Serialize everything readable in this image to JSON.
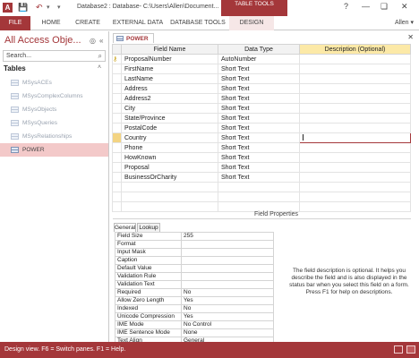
{
  "window": {
    "title": "Database2 : Database- C:\\Users\\Allen\\Document...",
    "contextual_group": "TABLE TOOLS",
    "app_icon": "A",
    "help": "?",
    "minimize": "—",
    "restore": "❏",
    "close": "✕",
    "qat": {
      "save": "💾",
      "undo": "↶",
      "undo_dropdown": "▾",
      "customize": "▾"
    }
  },
  "ribbon": {
    "tabs": [
      "FILE",
      "HOME",
      "CREATE",
      "EXTERNAL DATA",
      "DATABASE TOOLS",
      "DESIGN"
    ],
    "account": "Allen ▾"
  },
  "nav_pane": {
    "title": "All Access Obje...",
    "dropdown": "◎",
    "collapse": "«",
    "search_placeholder": "Search...",
    "search_icon": "⌕",
    "section": "Tables",
    "section_collapse": "˄",
    "items": [
      {
        "label": "MSysACEs",
        "active": false
      },
      {
        "label": "MSysComplexColumns",
        "active": false
      },
      {
        "label": "MSysObjects",
        "active": false
      },
      {
        "label": "MSysQueries",
        "active": false
      },
      {
        "label": "MSysRelationships",
        "active": false
      },
      {
        "label": "POWER",
        "active": true
      }
    ]
  },
  "document": {
    "tab": "POWER",
    "close": "✕",
    "columns": [
      "Field Name",
      "Data Type",
      "Description (Optional)"
    ],
    "key_icon": "⚷",
    "rows": [
      {
        "name": "ProposalNumber",
        "type": "AutoNumber",
        "desc": ""
      },
      {
        "name": "FirstName",
        "type": "Short Text",
        "desc": ""
      },
      {
        "name": "LastName",
        "type": "Short Text",
        "desc": ""
      },
      {
        "name": "Address",
        "type": "Short Text",
        "desc": ""
      },
      {
        "name": "Address2",
        "type": "Short Text",
        "desc": ""
      },
      {
        "name": "City",
        "type": "Short Text",
        "desc": ""
      },
      {
        "name": "State/Province",
        "type": "Short Text",
        "desc": ""
      },
      {
        "name": "PostalCode",
        "type": "Short Text",
        "desc": ""
      },
      {
        "name": "Country",
        "type": "Short Text",
        "desc": ""
      },
      {
        "name": "Phone",
        "type": "Short Text",
        "desc": ""
      },
      {
        "name": "HowKnown",
        "type": "Short Text",
        "desc": ""
      },
      {
        "name": "Proposal",
        "type": "Short Text",
        "desc": ""
      },
      {
        "name": "BusinessOrCharity",
        "type": "Short Text",
        "desc": ""
      },
      {
        "name": "",
        "type": "",
        "desc": ""
      },
      {
        "name": "",
        "type": "",
        "desc": ""
      },
      {
        "name": "",
        "type": "",
        "desc": ""
      }
    ],
    "current_row": 8
  },
  "field_properties": {
    "label": "Field Properties",
    "tabs": [
      "General",
      "Lookup"
    ],
    "rows": [
      [
        "Field Size",
        "255"
      ],
      [
        "Format",
        ""
      ],
      [
        "Input Mask",
        ""
      ],
      [
        "Caption",
        ""
      ],
      [
        "Default Value",
        ""
      ],
      [
        "Validation Rule",
        ""
      ],
      [
        "Validation Text",
        ""
      ],
      [
        "Required",
        "No"
      ],
      [
        "Allow Zero Length",
        "Yes"
      ],
      [
        "Indexed",
        "No"
      ],
      [
        "Unicode Compression",
        "Yes"
      ],
      [
        "IME Mode",
        "No Control"
      ],
      [
        "IME Sentence Mode",
        "None"
      ],
      [
        "Text Align",
        "General"
      ]
    ],
    "help": "The field description is optional. It helps you describe the field and is also displayed in the status bar when you select this field on a form. Press F1 for help on descriptions."
  },
  "status_bar": {
    "text": "Design view.  F6 = Switch panes.  F1 = Help."
  },
  "colors": {
    "accent": "#a4373a",
    "selected_row": "#f3c9c9",
    "header_selected": "#fce9a7"
  }
}
